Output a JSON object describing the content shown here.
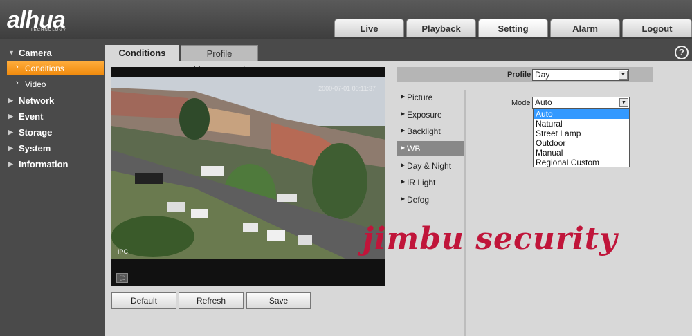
{
  "brand": {
    "logo": "alhua",
    "logo_sub": "TECHNOLOGY"
  },
  "nav": {
    "tabs": [
      "Live",
      "Playback",
      "Setting",
      "Alarm",
      "Logout"
    ],
    "active": "Setting"
  },
  "sidebar": {
    "sections": [
      {
        "label": "Camera",
        "expanded": true
      },
      {
        "label": "Network"
      },
      {
        "label": "Event"
      },
      {
        "label": "Storage"
      },
      {
        "label": "System"
      },
      {
        "label": "Information"
      }
    ],
    "camera_items": [
      {
        "label": "Conditions",
        "active": true
      },
      {
        "label": "Video"
      }
    ]
  },
  "tabs": {
    "active": "Conditions",
    "other": "Profile Management"
  },
  "help_icon": "?",
  "video": {
    "timestamp": "2000-07-01 00:11:37",
    "overlay": "IPC",
    "fullscreen_icon": "fullscreen-icon"
  },
  "buttons": {
    "default": "Default",
    "refresh": "Refresh",
    "save": "Save"
  },
  "profile": {
    "label": "Profile",
    "value": "Day"
  },
  "menu": [
    "Picture",
    "Exposure",
    "Backlight",
    "WB",
    "Day & Night",
    "IR Light",
    "Defog"
  ],
  "menu_active": "WB",
  "mode": {
    "label": "Mode",
    "value": "Auto",
    "options": [
      "Auto",
      "Natural",
      "Street Lamp",
      "Outdoor",
      "Manual",
      "Regional Custom"
    ],
    "highlighted": "Auto"
  },
  "watermark": "jimbu security",
  "colors": {
    "accent_orange": "#f59a1e",
    "selection_blue": "#3399ff",
    "watermark_red": "#c0153a"
  }
}
